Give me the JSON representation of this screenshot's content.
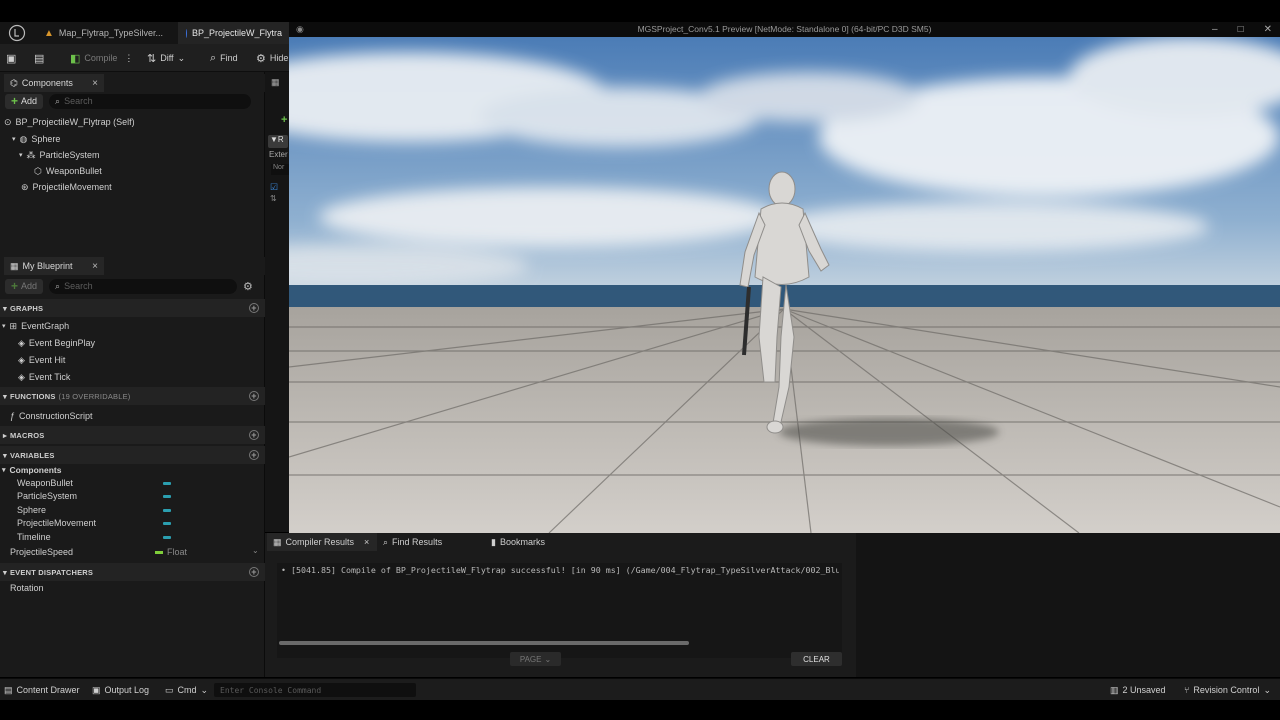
{
  "tabs": [
    {
      "label": "Map_Flytrap_TypeSilver...",
      "icon": "map-icon"
    },
    {
      "label": "BP_ProjectileW_Flytra",
      "icon": "blueprint-icon"
    }
  ],
  "toolbar": {
    "compile": "Compile",
    "diff": "Diff",
    "find": "Find",
    "hide": "Hide"
  },
  "components": {
    "tab_label": "Components",
    "add_label": "Add",
    "search_placeholder": "Search",
    "tree": [
      {
        "label": "BP_ProjectileW_Flytrap (Self)"
      },
      {
        "label": "Sphere"
      },
      {
        "label": "ParticleSystem"
      },
      {
        "label": "WeaponBullet"
      },
      {
        "label": "ProjectileMovement"
      }
    ]
  },
  "my_blueprint": {
    "tab_label": "My Blueprint",
    "add_label": "Add",
    "search_placeholder": "Search",
    "graphs_header": "GRAPHS",
    "graphs": [
      "EventGraph",
      "Event BeginPlay",
      "Event Hit",
      "Event Tick"
    ],
    "functions_header": "FUNCTIONS",
    "functions_sub": "(19 OVERRIDABLE)",
    "functions": [
      "ConstructionScript"
    ],
    "macros_header": "MACROS",
    "variables_header": "VARIABLES",
    "variables_group": "Components",
    "variables": [
      "WeaponBullet",
      "ParticleSystem",
      "Sphere",
      "ProjectileMovement",
      "Timeline"
    ],
    "projectile_speed": {
      "name": "ProjectileSpeed",
      "type": "Float"
    },
    "dispatchers_header": "EVENT DISPATCHERS",
    "dispatchers": [
      "Rotation"
    ]
  },
  "midstrip": {
    "label1": "Exter",
    "label2": "Nor"
  },
  "viewport": {
    "title": "MGSProject_Conv5.1 Preview [NetMode: Standalone 0]  (64-bit/PC D3D SM5)"
  },
  "bottom": {
    "tabs": [
      "Compiler Results",
      "Find Results",
      "Bookmarks"
    ],
    "log_line": "[5041.85] Compile of BP_ProjectileW_Flytrap successful! [in 90 ms] (/Game/004_Flytrap_TypeSilverAttack/002_Blueprints",
    "page_label": "PAGE",
    "clear_label": "CLEAR"
  },
  "statusbar": {
    "content_drawer": "Content Drawer",
    "output_log": "Output Log",
    "cmd": "Cmd",
    "console_placeholder": "Enter Console Command",
    "unsaved": "2 Unsaved",
    "revision_control": "Revision Control"
  },
  "colors": {
    "accent_green": "#6cc04a",
    "variable_pill": "#2b9fb0",
    "float_pill": "#7fce3a"
  }
}
